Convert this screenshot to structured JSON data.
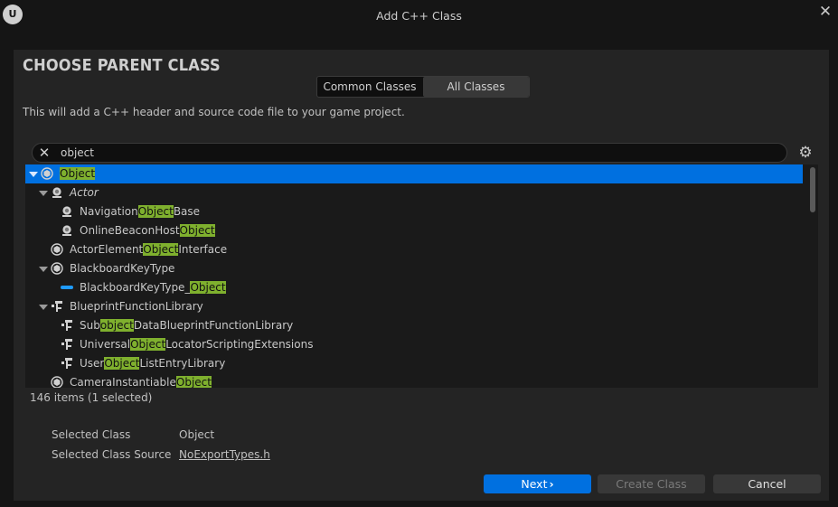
{
  "window": {
    "title": "Add C++ Class",
    "logo_text": "U"
  },
  "heading": "CHOOSE PARENT CLASS",
  "tabs": {
    "common": "Common Classes",
    "all": "All Classes",
    "active": "all"
  },
  "description": "This will add a C++ header and source code file to your game project.",
  "search": {
    "value": "object",
    "placeholder": ""
  },
  "tree": {
    "rows": [
      {
        "depth": 0,
        "expanded": true,
        "icon": "class-icon",
        "pre": "",
        "match": "Object",
        "post": "",
        "italic": false,
        "selected": true
      },
      {
        "depth": 1,
        "expanded": true,
        "icon": "actor-icon",
        "pre": "Actor",
        "match": "",
        "post": "",
        "italic": true,
        "selected": false
      },
      {
        "depth": 2,
        "expanded": false,
        "icon": "actor-icon",
        "pre": "Navigation",
        "match": "Object",
        "post": "Base",
        "italic": false,
        "selected": false
      },
      {
        "depth": 2,
        "expanded": false,
        "icon": "actor-icon",
        "pre": "OnlineBeaconHost",
        "match": "Object",
        "post": "",
        "italic": false,
        "selected": false
      },
      {
        "depth": 1,
        "expanded": false,
        "icon": "class-icon",
        "pre": "ActorElement",
        "match": "Object",
        "post": "Interface",
        "italic": false,
        "selected": false
      },
      {
        "depth": 1,
        "expanded": true,
        "icon": "class-icon",
        "pre": "BlackboardKeyType",
        "match": "",
        "post": "",
        "italic": false,
        "selected": false
      },
      {
        "depth": 2,
        "expanded": false,
        "icon": "key-type-icon",
        "pre": "BlackboardKeyType_",
        "match": "Object",
        "post": "",
        "italic": false,
        "selected": false
      },
      {
        "depth": 1,
        "expanded": true,
        "icon": "function-library-icon",
        "pre": "BlueprintFunctionLibrary",
        "match": "",
        "post": "",
        "italic": false,
        "selected": false
      },
      {
        "depth": 2,
        "expanded": false,
        "icon": "function-library-icon",
        "pre": "Sub",
        "match": "object",
        "post": "DataBlueprintFunctionLibrary",
        "italic": false,
        "selected": false
      },
      {
        "depth": 2,
        "expanded": false,
        "icon": "function-library-icon",
        "pre": "Universal",
        "match": "Object",
        "post": "LocatorScriptingExtensions",
        "italic": false,
        "selected": false
      },
      {
        "depth": 2,
        "expanded": false,
        "icon": "function-library-icon",
        "pre": "User",
        "match": "Object",
        "post": "ListEntryLibrary",
        "italic": false,
        "selected": false
      },
      {
        "depth": 1,
        "expanded": false,
        "icon": "class-icon",
        "pre": "CameraInstantiable",
        "match": "Object",
        "post": "",
        "italic": false,
        "selected": false
      }
    ]
  },
  "status": {
    "count": "146 items (1 selected)"
  },
  "info": {
    "selected_class_label": "Selected Class",
    "selected_class_value": "Object",
    "selected_source_label": "Selected Class Source",
    "selected_source_value": "NoExportTypes.h"
  },
  "buttons": {
    "next": "Next",
    "create": "Create Class",
    "cancel": "Cancel"
  },
  "colors": {
    "accent": "#0070e0",
    "highlight": "#7fb02e",
    "panel": "#242424",
    "background": "#151515"
  }
}
